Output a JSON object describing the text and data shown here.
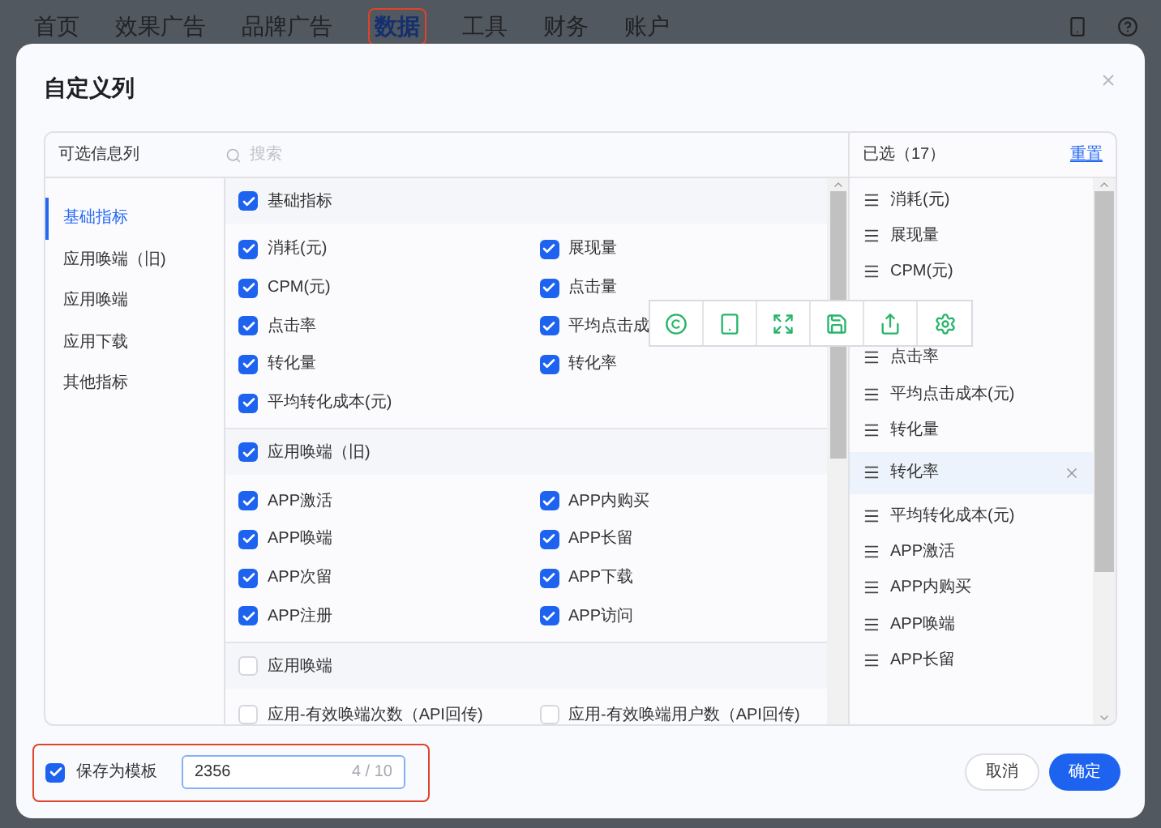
{
  "nav": {
    "items": [
      {
        "label": "首页",
        "selected": false
      },
      {
        "label": "效果广告",
        "selected": false
      },
      {
        "label": "品牌广告",
        "selected": false
      },
      {
        "label": "数据",
        "selected": true
      },
      {
        "label": "工具",
        "selected": false
      },
      {
        "label": "财务",
        "selected": false
      },
      {
        "label": "账户",
        "selected": false
      }
    ]
  },
  "dialog": {
    "title": "自定义列",
    "available": {
      "header": "可选信息列",
      "search_placeholder": "搜索",
      "categories": [
        {
          "label": "基础指标",
          "selected": true
        },
        {
          "label": "应用唤端（旧)",
          "selected": false
        },
        {
          "label": "应用唤端",
          "selected": false
        },
        {
          "label": "应用下载",
          "selected": false
        },
        {
          "label": "其他指标",
          "selected": false
        }
      ],
      "groups": [
        {
          "label": "基础指标",
          "checked": true,
          "items": [
            {
              "label": "消耗(元)",
              "checked": true
            },
            {
              "label": "展现量",
              "checked": true
            },
            {
              "label": "CPM(元)",
              "checked": true
            },
            {
              "label": "点击量",
              "checked": true
            },
            {
              "label": "点击率",
              "checked": true
            },
            {
              "label": "平均点击成",
              "checked": true
            },
            {
              "label": "转化量",
              "checked": true
            },
            {
              "label": "转化率",
              "checked": true
            },
            {
              "label": "平均转化成本(元)",
              "checked": true
            }
          ]
        },
        {
          "label": "应用唤端（旧)",
          "checked": true,
          "items": [
            {
              "label": "APP激活",
              "checked": true
            },
            {
              "label": "APP内购买",
              "checked": true
            },
            {
              "label": "APP唤端",
              "checked": true
            },
            {
              "label": "APP长留",
              "checked": true
            },
            {
              "label": "APP次留",
              "checked": true
            },
            {
              "label": "APP下载",
              "checked": true
            },
            {
              "label": "APP注册",
              "checked": true
            },
            {
              "label": "APP访问",
              "checked": true
            }
          ]
        },
        {
          "label": "应用唤端",
          "checked": false,
          "items": [
            {
              "label": "应用-有效唤端次数（API回传)",
              "checked": false
            },
            {
              "label": "应用-有效唤端用户数（API回传)",
              "checked": false
            }
          ]
        }
      ]
    },
    "selected": {
      "title": "已选（17）",
      "reset": "重置",
      "items": [
        {
          "label": "消耗(元)",
          "hovered": false
        },
        {
          "label": "展现量",
          "hovered": false
        },
        {
          "label": "CPM(元)",
          "hovered": false
        },
        {
          "label": "点击率",
          "hovered": false
        },
        {
          "label": "平均点击成本(元)",
          "hovered": false
        },
        {
          "label": "转化量",
          "hovered": false
        },
        {
          "label": "转化率",
          "hovered": true
        },
        {
          "label": "平均转化成本(元)",
          "hovered": false
        },
        {
          "label": "APP激活",
          "hovered": false
        },
        {
          "label": "APP内购买",
          "hovered": false
        },
        {
          "label": "APP唤端",
          "hovered": false
        },
        {
          "label": "APP长留",
          "hovered": false
        }
      ]
    },
    "footer": {
      "save_template": {
        "label": "保存为模板",
        "checked": true
      },
      "template_name": {
        "value": "2356",
        "counter": "4 / 10"
      },
      "cancel": "取消",
      "confirm": "确定"
    }
  }
}
